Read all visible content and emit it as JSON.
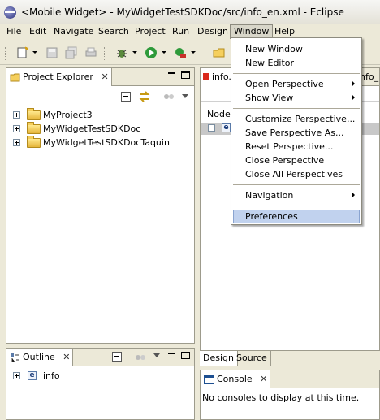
{
  "window": {
    "title": "<Mobile Widget> - MyWidgetTestSDKDoc/src/info_en.xml - Eclipse"
  },
  "menubar": {
    "items": [
      "File",
      "Edit",
      "Navigate",
      "Search",
      "Project",
      "Run",
      "Design",
      "Window",
      "Help"
    ],
    "open_item": "Window"
  },
  "window_menu": {
    "items": [
      {
        "label": "New Window"
      },
      {
        "label": "New Editor"
      },
      {
        "label": "Open Perspective",
        "submenu": true
      },
      {
        "label": "Show View",
        "submenu": true
      },
      {
        "label": "Customize Perspective..."
      },
      {
        "label": "Save Perspective As..."
      },
      {
        "label": "Reset Perspective..."
      },
      {
        "label": "Close Perspective"
      },
      {
        "label": "Close All Perspectives"
      },
      {
        "label": "Navigation",
        "submenu": true
      },
      {
        "label": "Preferences",
        "highlighted": true
      }
    ]
  },
  "project_explorer": {
    "title": "Project Explorer",
    "items": [
      "MyProject3",
      "MyWidgetTestSDKDoc",
      "MyWidgetTestSDKDocTaquin"
    ]
  },
  "outline": {
    "title": "Outline",
    "items": [
      "info"
    ]
  },
  "editor": {
    "tab_partial": "info.",
    "tab2_partial": "nfo_",
    "column_header_partial": "Node",
    "row_icon_label": "e",
    "bottom_tabs": [
      "Design",
      "Source"
    ]
  },
  "console": {
    "title": "Console",
    "message": "No consoles to display at this time."
  },
  "colors": {
    "menu_highlight": "#c1d2ee",
    "chrome": "#ece9d8",
    "border": "#9d9b8c"
  }
}
